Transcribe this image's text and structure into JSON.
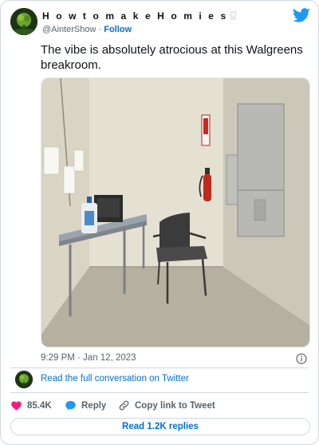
{
  "author": {
    "display_name": "H o w t o m a k e H o m i e s",
    "handle": "@AinterShow",
    "separator": "·",
    "follow_label": "Follow"
  },
  "tweet": {
    "text": "The vibe is absolutely atrocious at this Walgreens breakroom.",
    "timestamp": "9:29 PM · Jan 12, 2023"
  },
  "conversation": {
    "link_text": "Read the full conversation on Twitter"
  },
  "actions": {
    "likes_count": "85.4K",
    "reply_label": "Reply",
    "copy_label": "Copy link to Tweet"
  },
  "replies_button": {
    "label": "Read 1.2K replies"
  },
  "icons": {
    "brand": "twitter-bird-icon",
    "info": "info-icon",
    "like": "heart-icon",
    "reply": "speech-bubble-icon",
    "copy": "link-icon",
    "emoji": "tooth-emoji"
  },
  "colors": {
    "link": "#006fd6",
    "brand": "#1d9bf0",
    "like": "#f91880",
    "muted": "#536471",
    "text": "#0f1419",
    "border": "#cfd9de"
  }
}
